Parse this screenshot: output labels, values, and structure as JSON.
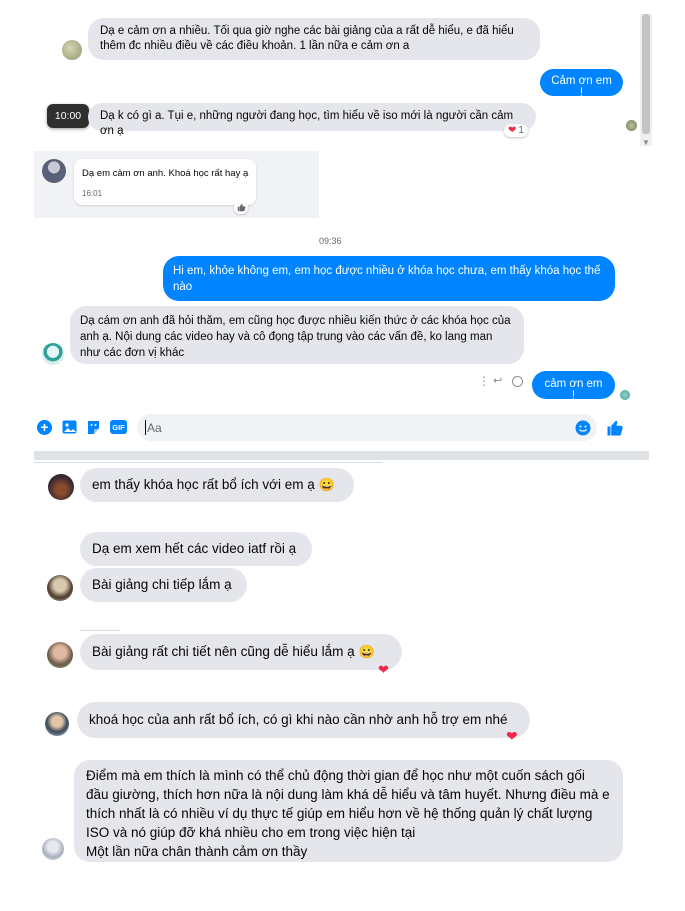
{
  "top": {
    "msg1": "Dạ e cảm ơn a nhiều. Tối qua giờ nghe các bài giảng của a rất dễ hiểu, e đã hiểu thêm đc nhiều điều về các điều khoản. 1 lần nữa e cảm ơn a",
    "msg2": "Cảm ơn em !",
    "tooltip_time": "10:00",
    "msg3": "Dạ k có gì a. Tụi e, những người đang học, tìm hiểu về iso mới là người cần cảm ơn ạ",
    "msg3_reaction_count": "1"
  },
  "card": {
    "msg": "Dạ em cảm ơn anh. Khoá học rất hay ạ",
    "time": "16:01"
  },
  "chat2": {
    "time_divider": "09:36",
    "msg1": "Hi em, khỏe không em, em học được nhiều ở khóa học chưa, em thấy khóa học thế nào",
    "msg2": "Dạ cám ơn anh đã hỏi thăm, em cũng học được nhiều kiến thức ở các khóa học của anh ạ. Nội dung các video hay và cô đọng tập trung vào các vấn đề, ko lang man như các đơn vị khác",
    "msg3": "cảm ơn em !",
    "composer_placeholder": "Aa",
    "gif_label": "GIF"
  },
  "feedback": [
    {
      "text": "em thấy khóa học rất bổ ích với em ạ"
    },
    {
      "text": "Dạ em xem hết các video iatf rồi ạ"
    },
    {
      "text": "Bài giảng chi tiếp lắm ạ"
    },
    {
      "text": "Bài giảng rất chi tiết nên cũng dễ hiểu lắm ạ"
    },
    {
      "text": "khoá học của anh rất bổ ích, có gì khi nào cần nhờ anh hỗ trợ em nhé"
    },
    {
      "lines": [
        "Điểm mà em thích là mình có thể chủ động thời gian để học như một cuốn sách gối đầu giường, thích hơn nữa là nội dung làm khá dễ hiểu và tâm huyết. Nhưng điều mà e thích nhất là có nhiều ví dụ thực tế giúp em hiểu hơn về hệ thống quản lý chất lượng ISO và nó giúp đỡ khá nhiều cho em trong việc hiện tại",
        "Một lần nữa chân thành cảm ơn thầy"
      ]
    }
  ],
  "icons": {
    "smile_emoji": "😀",
    "heart": "❤",
    "messenger_blue": "#0084ff",
    "bubble_gray": "#e4e6eb",
    "heart_red": "#f02849"
  }
}
